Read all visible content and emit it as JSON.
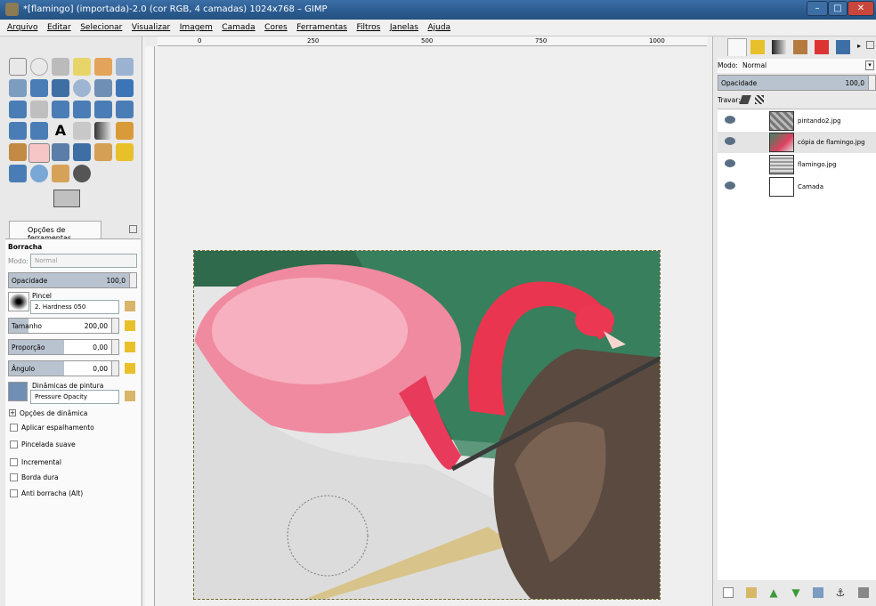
{
  "window": {
    "title": "*[flamingo] (importada)-2.0 (cor RGB, 4 camadas) 1024x768 – GIMP",
    "minimize": "–",
    "maximize": "□",
    "close": "✕"
  },
  "menu": [
    "Arquivo",
    "Editar",
    "Selecionar",
    "Visualizar",
    "Imagem",
    "Camada",
    "Cores",
    "Ferramentas",
    "Filtros",
    "Janelas",
    "Ajuda"
  ],
  "ruler": {
    "ticks": [
      "0",
      "250",
      "500",
      "750",
      "1000"
    ]
  },
  "tool_options": {
    "tab_label": "Opções de ferramentas",
    "tool_name": "Borracha",
    "mode_label": "Modo:",
    "mode_value": "Normal",
    "opacity": {
      "label": "Opacidade",
      "value": "100,0",
      "fraction": 1.0
    },
    "brush": {
      "label": "Pincel",
      "value": "2. Hardness 050"
    },
    "size": {
      "label": "Tamanho",
      "value": "200,00",
      "fraction": 0.18
    },
    "ratio": {
      "label": "Proporção",
      "value": "0,00",
      "fraction": 0.5
    },
    "angle": {
      "label": "Ângulo",
      "value": "0,00",
      "fraction": 0.5
    },
    "dynamics": {
      "label": "Dinâmicas de pintura",
      "value": "Pressure Opacity"
    },
    "dynamics_options": "Opções de dinâmica",
    "checkboxes": [
      "Aplicar espalhamento",
      "Pincelada suave",
      "Incremental",
      "Borda dura",
      "Anti borracha (Alt)"
    ]
  },
  "layers": {
    "mode_label": "Modo:",
    "mode_value": "Normal",
    "opacity_label": "Opacidade",
    "opacity_value": "100,0",
    "lock_label": "Travar:",
    "items": [
      {
        "name": "pintando2.jpg"
      },
      {
        "name": "cópia de flamingo.jpg"
      },
      {
        "name": "flamingo.jpg"
      },
      {
        "name": "Camada"
      }
    ]
  },
  "colors": {
    "titlebar": "#2a5a8f",
    "close_button": "#c9463d",
    "active_tool": "#f6c6c6"
  }
}
